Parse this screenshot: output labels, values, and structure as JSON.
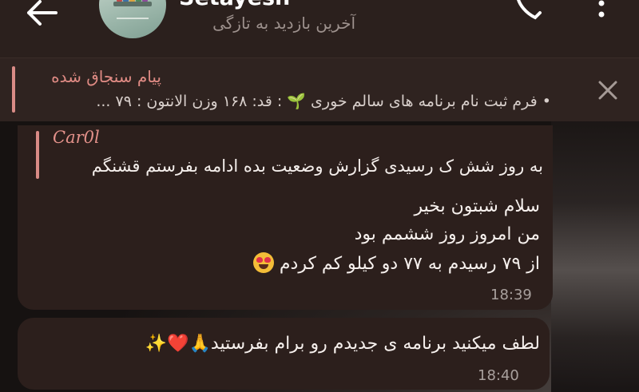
{
  "header": {
    "title": "Setayesh",
    "status": "آخرین بازدید به تازگی"
  },
  "pinned": {
    "title": "پیام سنجاق شده",
    "text": "• فرم ثبت نام برنامه های سالم خوری 🌱 : قد: ۱۶۸ وزن الانتون : ۷۹ ..."
  },
  "messages": [
    {
      "reply_name": "Car0l",
      "reply_text": "به روز شش ک رسیدی گزارش وضعیت بده ادامه بفرستم قشنگم",
      "lines": [
        "سلام شبتون بخیر",
        "من امروز روز ششمم بود",
        "از ۷۹ رسیدم به ۷۷ دو کیلو کم کردم"
      ],
      "time": "18:39"
    },
    {
      "text": "لطف میکنید برنامه ی جدیدم رو برام بفرستید",
      "emojis": "🙏❤️✨",
      "time": "18:40"
    }
  ],
  "colors": {
    "accent": "#e08b84",
    "bubble": "#2c1f1c",
    "header": "#2b201d"
  },
  "icons": {
    "back": "arrow-left-icon",
    "call": "phone-icon",
    "menu": "more-vertical-icon",
    "close": "close-icon"
  }
}
